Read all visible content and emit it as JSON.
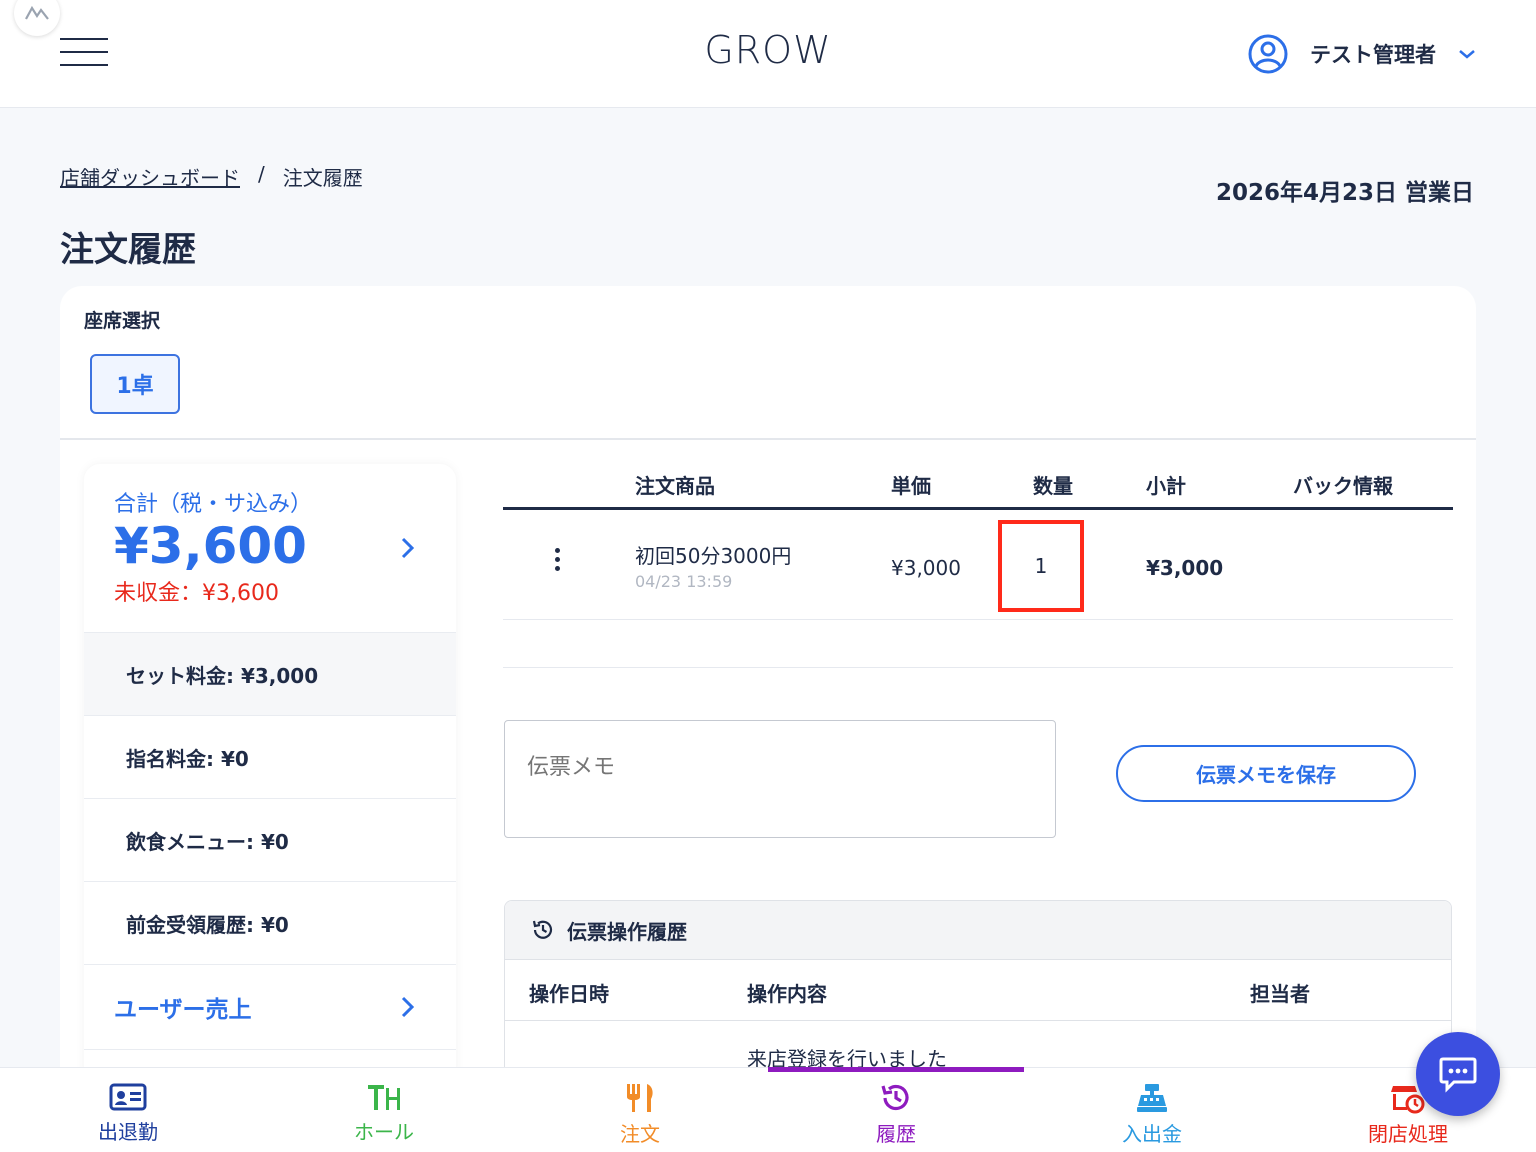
{
  "header": {
    "app_title": "GROW",
    "user_name": "テスト管理者"
  },
  "breadcrumb": {
    "parent": "店舗ダッシュボード",
    "separator": "/",
    "current": "注文履歴"
  },
  "business_date": "2026年4月23日 営業日",
  "page_title": "注文履歴",
  "seat_selection": {
    "label": "座席選択",
    "seats": [
      "1卓"
    ],
    "selected": "1卓"
  },
  "summary": {
    "total_label": "合計（税・サ込み）",
    "total_amount": "¥3,600",
    "unpaid": "未収金：¥3,600",
    "rows": [
      "セット料金: ¥3,000",
      "指名料金: ¥0",
      "飲食メニュー: ¥0",
      "前金受領履歴: ¥0"
    ],
    "user_sales": "ユーザー売上"
  },
  "order_table": {
    "columns": [
      "注文商品",
      "単価",
      "数量",
      "小計",
      "バック情報"
    ],
    "rows": [
      {
        "item": "初回50分3000円",
        "time": "04/23 13:59",
        "unit_price": "¥3,000",
        "quantity": "1",
        "subtotal": "¥3,000",
        "back_info": ""
      }
    ]
  },
  "memo": {
    "placeholder": "伝票メモ",
    "save_label": "伝票メモを保存"
  },
  "operation_history": {
    "title": "伝票操作履歴",
    "columns": [
      "操作日時",
      "操作内容",
      "担当者"
    ],
    "rows": [
      {
        "datetime": "",
        "content": "来店登録を行いました",
        "staff": ""
      }
    ]
  },
  "bottom_nav": [
    {
      "label": "出退勤",
      "color": "#1f3f9e",
      "icon": "id-card-icon"
    },
    {
      "label": "ホール",
      "color": "#3bb54a",
      "icon": "table-icon"
    },
    {
      "label": "注文",
      "color": "#f28c28",
      "icon": "fork-knife-icon"
    },
    {
      "label": "履歴",
      "color": "#8e1bbf",
      "icon": "history-icon"
    },
    {
      "label": "入出金",
      "color": "#2a9ae0",
      "icon": "cash-register-icon"
    },
    {
      "label": "閉店処理",
      "color": "#e8291c",
      "icon": "close-store-icon"
    }
  ],
  "active_nav": "履歴"
}
